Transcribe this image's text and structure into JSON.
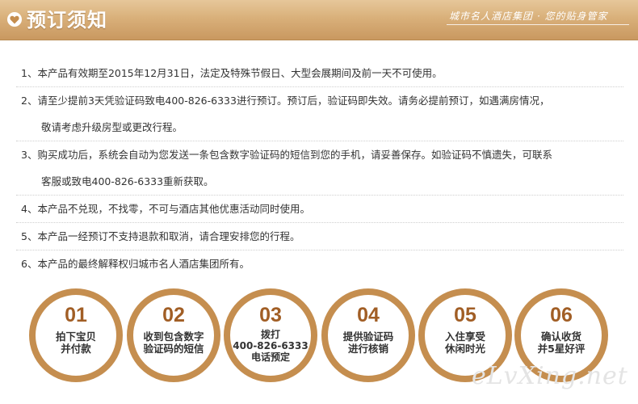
{
  "header": {
    "title": "预订须知",
    "slogan": "城市名人酒店集团 · 您的贴身管家",
    "icon": "heart-icon",
    "accent_color": "#c58e4f"
  },
  "notice": [
    {
      "lines": [
        "1、本产品有效期至2015年12月31日，法定及特殊节假日、大型会展期间及前一天不可使用。"
      ]
    },
    {
      "lines": [
        "2、请至少提前3天凭验证码致电400-826-6333进行预订。预订后，验证码即失效。请务必提前预订，如遇满房情况，",
        "敬请考虑升级房型或更改行程。"
      ]
    },
    {
      "lines": [
        "3、购买成功后，系统会自动为您发送一条包含数字验证码的短信到您的手机，请妥善保存。如验证码不慎遗失，可联系",
        "客服或致电400-826-6333重新获取。"
      ]
    },
    {
      "lines": [
        "4、本产品不兑现，不找零，不可与酒店其他优惠活动同时使用。"
      ]
    },
    {
      "lines": [
        "5、本产品一经预订不支持退款和取消，请合理安排您的行程。"
      ]
    },
    {
      "lines": [
        "6、本产品的最终解释权归城市名人酒店集团所有。"
      ]
    }
  ],
  "steps": [
    {
      "num": "01",
      "lines": [
        "拍下宝贝",
        "并付款"
      ]
    },
    {
      "num": "02",
      "lines": [
        "收到包含数字",
        "验证码的短信"
      ]
    },
    {
      "num": "03",
      "lines": [
        "拨打",
        "400-826-6333",
        "电话预定"
      ]
    },
    {
      "num": "04",
      "lines": [
        "提供验证码",
        "进行核销"
      ]
    },
    {
      "num": "05",
      "lines": [
        "入住享受",
        "休闲时光"
      ]
    },
    {
      "num": "06",
      "lines": [
        "确认收货",
        "并5星好评"
      ]
    }
  ],
  "watermark": "eLvXing.net"
}
